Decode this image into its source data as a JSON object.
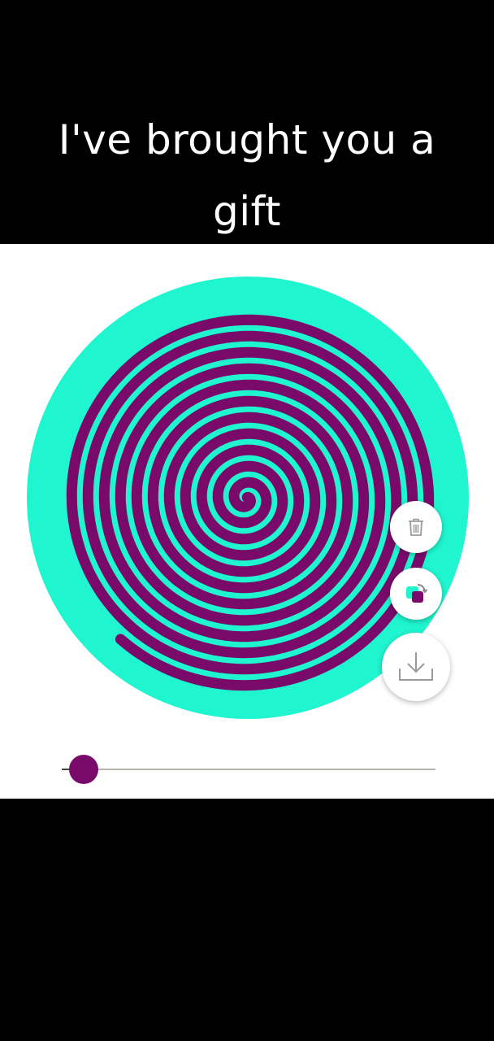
{
  "caption": {
    "line1": "I've brought you a",
    "line2": "gift"
  },
  "colors": {
    "background": "#000000",
    "canvas": "#ffffff",
    "disc": "#1ff5cf",
    "spiral": "#7a0a6a",
    "slider_thumb": "#7a0a6a",
    "slider_track": "#b5b5ae",
    "icon_stroke": "#9a9a9a"
  },
  "spiral": {
    "turns": 11.5
  },
  "actions": {
    "delete_icon": "trash-icon",
    "layers_icon": "layers-icon",
    "download_icon": "download-icon"
  },
  "slider": {
    "value": 0.05
  }
}
